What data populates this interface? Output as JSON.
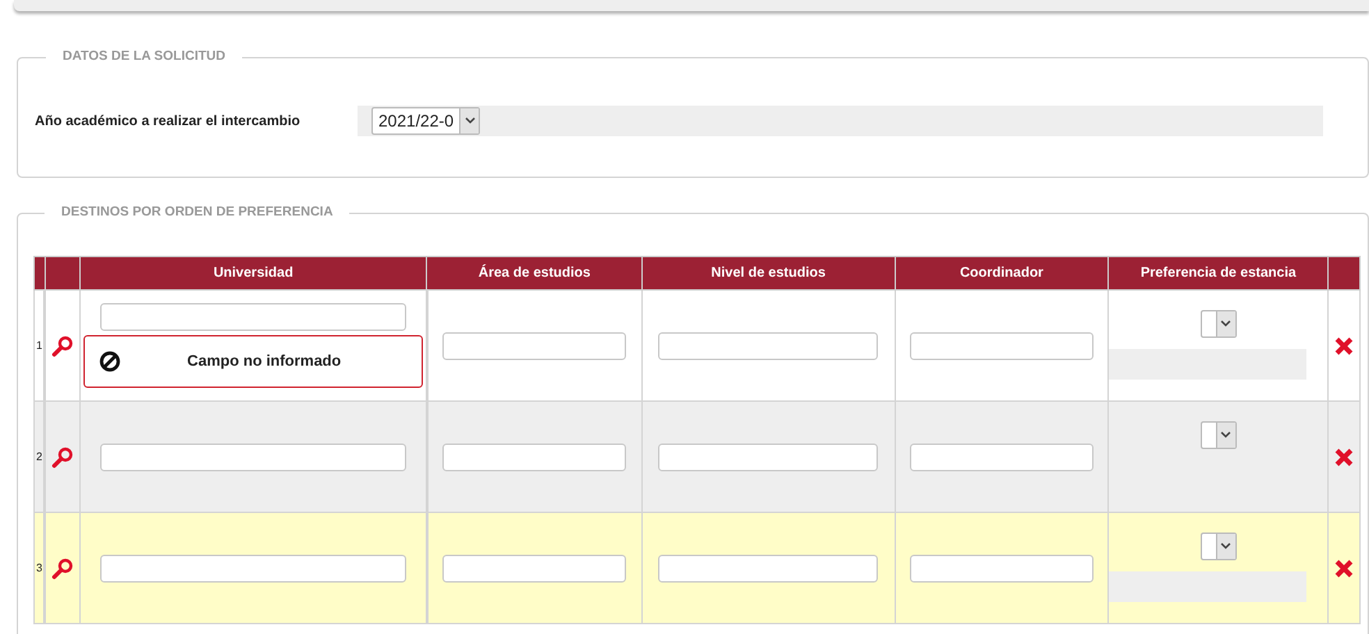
{
  "request_section": {
    "legend": "DATOS DE LA SOLICITUD",
    "year_label": "Año académico a realizar el intercambio",
    "year_value": "2021/22-0"
  },
  "destinations_section": {
    "legend": "DESTINOS POR ORDEN DE PREFERENCIA",
    "columns": [
      "Universidad",
      "Área de estudios",
      "Nivel de estudios",
      "Coordinador",
      "Preferencia de estancia"
    ],
    "rows": [
      {
        "number": "1",
        "color": "#ffffff",
        "error": "Campo no informado",
        "kind": "with_note"
      },
      {
        "number": "2",
        "color": "#eeeeee",
        "kind": "plain"
      },
      {
        "number": "3",
        "color": "#fffdc8",
        "kind": "with_note"
      }
    ]
  }
}
